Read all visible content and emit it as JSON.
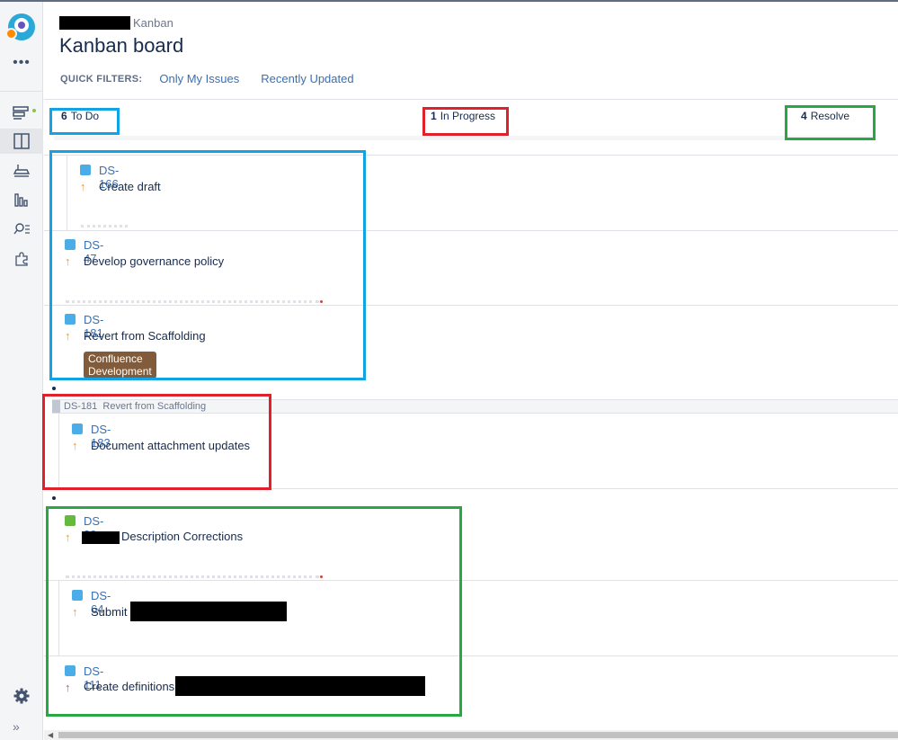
{
  "header": {
    "breadcrumb_suffix": "Kanban",
    "title": "Kanban board"
  },
  "quick_filters": {
    "label": "QUICK FILTERS:",
    "items": [
      "Only My Issues",
      "Recently Updated"
    ]
  },
  "columns": [
    {
      "count": "6",
      "name": "To Do"
    },
    {
      "count": "1",
      "name": "In Progress"
    },
    {
      "count": "4",
      "name": "Resolve"
    }
  ],
  "todo_cards": [
    {
      "key": "DS-166",
      "summary": "Create draft",
      "type": "subtask-icon",
      "priority": "↑"
    },
    {
      "key": "DS-47",
      "summary": "Develop governance policy",
      "type": "task-icon",
      "priority": "↑"
    },
    {
      "key": "DS-181",
      "summary": "Revert from Scaffolding",
      "type": "task-icon",
      "priority": "↑",
      "epic": "Confluence Development"
    }
  ],
  "inprogress": {
    "parent_key": "DS-181",
    "parent_summary": "Revert from Scaffolding",
    "cards": [
      {
        "key": "DS-183",
        "summary": "Document attachment updates",
        "type": "subtask-icon",
        "priority": "↑"
      }
    ]
  },
  "resolve_cards": [
    {
      "key": "DS-29",
      "summary": "Description Corrections",
      "type": "story-icon",
      "priority": "↑"
    },
    {
      "key": "DS-64",
      "summary": "Submit",
      "type": "subtask-icon",
      "priority": "↑"
    },
    {
      "key": "DS-111",
      "summary": "Create definitions",
      "type": "task-icon",
      "priority": "↑"
    }
  ],
  "colors": {
    "annotation_blue": "#12a3e6",
    "annotation_red": "#e0202b",
    "annotation_green": "#27a844",
    "link": "#3a6fb0",
    "epic": "#815b3a",
    "priority_high": "#f79232",
    "priority_highest": "#e54937"
  }
}
